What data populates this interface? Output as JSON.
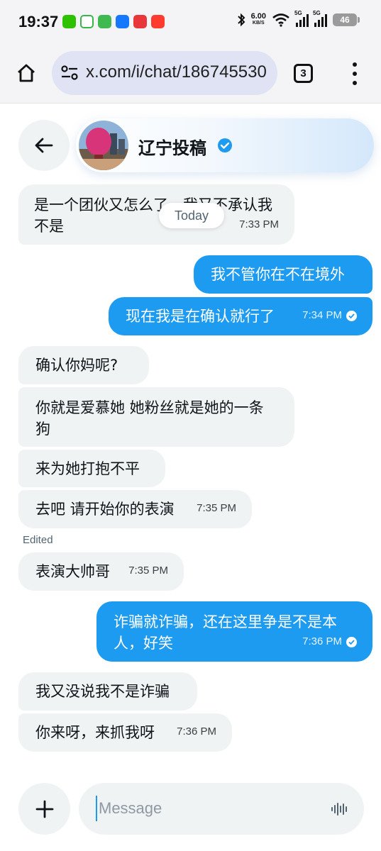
{
  "status_bar": {
    "time": "19:37",
    "net_speed_value": "6.00",
    "net_speed_unit": "KB/S",
    "signal1_label": "5G",
    "signal2_label": "5G",
    "battery": "46"
  },
  "browser": {
    "url": "x.com/i/chat/186745530",
    "tab_count": "3"
  },
  "chat": {
    "name": "辽宁投稿",
    "header_time": "7:33 PM",
    "today_label": "Today",
    "edited_label": "Edited",
    "messages": [
      {
        "dir": "in",
        "text": "是一个团伙又怎么了，我又不承认我不是",
        "time": "7:33 PM"
      },
      {
        "dir": "out",
        "text": "我不管你在不在境外",
        "time": ""
      },
      {
        "dir": "out",
        "text": "现在我是在确认就行了",
        "time": "7:34 PM"
      },
      {
        "dir": "in",
        "text": "确认你妈呢?",
        "time": ""
      },
      {
        "dir": "in",
        "text": "你就是爱慕她 她粉丝就是她的一条狗",
        "time": ""
      },
      {
        "dir": "in",
        "text": "来为她打抱不平",
        "time": ""
      },
      {
        "dir": "in",
        "text": "去吧 请开始你的表演",
        "time": "7:35 PM"
      },
      {
        "dir": "in",
        "text": "表演大帅哥",
        "time": "7:35 PM"
      },
      {
        "dir": "out",
        "text": "诈骗就诈骗，还在这里争是不是本人，好笑",
        "time": "7:36 PM"
      },
      {
        "dir": "in",
        "text": "我又没说我不是诈骗",
        "time": ""
      },
      {
        "dir": "in",
        "text": "你来呀，来抓我呀",
        "time": "7:36 PM"
      }
    ]
  },
  "composer": {
    "placeholder": "Message"
  },
  "colors": {
    "accent": "#1d9bf0",
    "incoming_bubble": "#eff3f4",
    "text": "#0f1419"
  },
  "icons": {
    "back": "arrow-left-icon",
    "verified": "verified-badge-icon",
    "read": "check-circle-icon",
    "plus": "plus-icon",
    "voice": "voice-waveform-icon",
    "home": "home-icon",
    "site_settings": "site-settings-icon",
    "menu": "more-vertical-icon"
  }
}
